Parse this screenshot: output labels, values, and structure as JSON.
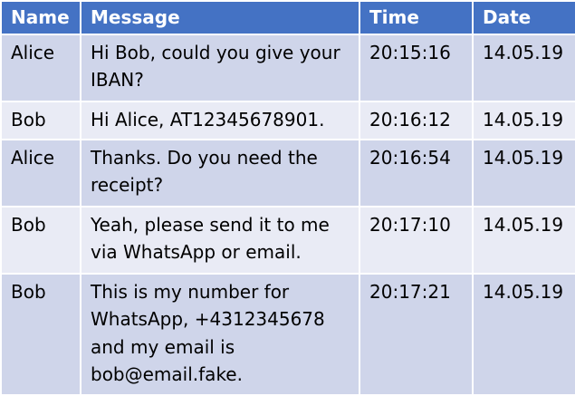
{
  "table": {
    "headers": [
      "Name",
      "Message",
      "Time",
      "Date"
    ],
    "rows": [
      {
        "name": "Alice",
        "message": "Hi Bob, could you give your IBAN?",
        "time": "20:15:16",
        "date": "14.05.19"
      },
      {
        "name": "Bob",
        "message": "Hi Alice, AT12345678901.",
        "time": "20:16:12",
        "date": "14.05.19"
      },
      {
        "name": "Alice",
        "message": "Thanks. Do you need the receipt?",
        "time": "20:16:54",
        "date": "14.05.19"
      },
      {
        "name": "Bob",
        "message": "Yeah, please send it to me via WhatsApp or email.",
        "time": "20:17:10",
        "date": "14.05.19"
      },
      {
        "name": "Bob",
        "message": "This is my number for WhatsApp, +4312345678 and my email is bob@email.fake.",
        "time": "20:17:21",
        "date": "14.05.19"
      }
    ]
  },
  "colors": {
    "header_bg": "#4472c4",
    "header_text": "#ffffff",
    "row_odd_bg": "#cfd5ea",
    "row_even_bg": "#e9ebf5"
  }
}
